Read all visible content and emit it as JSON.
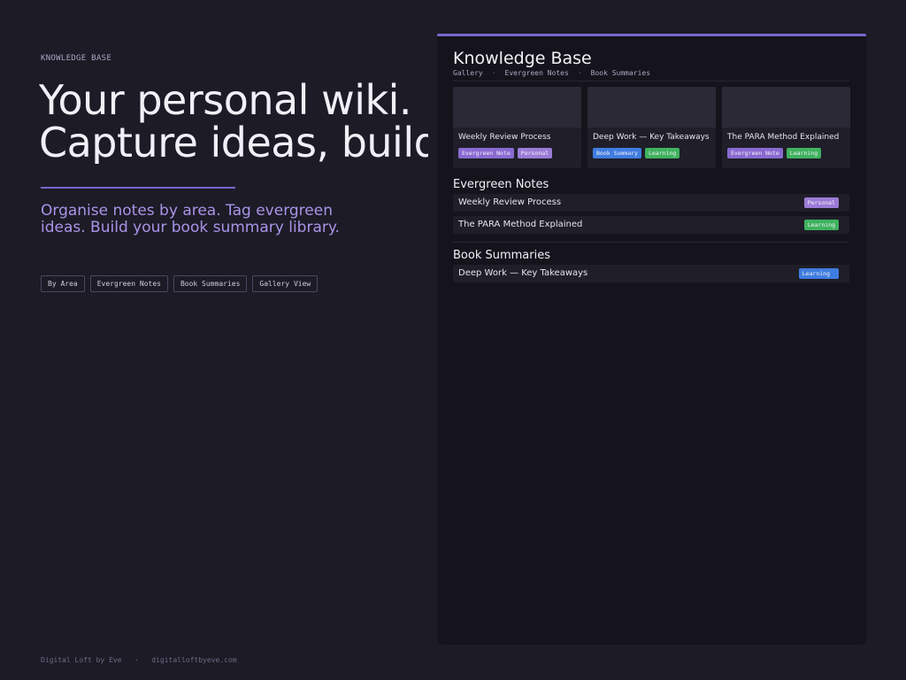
{
  "hero": {
    "eyebrow": "KNOWLEDGE BASE",
    "headline_line1": "Your personal wiki.",
    "headline_line2": "Capture ideas, build knowledge.",
    "subtitle": "Organise notes by area. Tag evergreen ideas. Build your book summary library.",
    "pills": [
      "By Area",
      "Evergreen Notes",
      "Book Summaries",
      "Gallery View"
    ]
  },
  "footer": {
    "brand": "Digital Loft by Eve",
    "separator": "·",
    "url": "digitalloftbyeve.com"
  },
  "panel": {
    "title": "Knowledge Base",
    "nav": [
      "Gallery",
      "Evergreen Notes",
      "Book Summaries"
    ],
    "nav_separator": "·",
    "cards": [
      {
        "title": "Weekly Review Process",
        "tags": [
          {
            "label": "Evergreen Note",
            "color": "#8a6ad1"
          },
          {
            "label": "Personal",
            "color": "#9b7bd6"
          }
        ]
      },
      {
        "title": "Deep Work — Key Takeaways",
        "tags": [
          {
            "label": "Book Summary",
            "color": "#3f7ce0"
          },
          {
            "label": "Learning",
            "color": "#3fb25e"
          }
        ]
      },
      {
        "title": "The PARA Method Explained",
        "tags": [
          {
            "label": "Evergreen Note",
            "color": "#8a6ad1"
          },
          {
            "label": "Learning",
            "color": "#3fb25e"
          }
        ]
      }
    ],
    "evergreen": {
      "title": "Evergreen Notes",
      "rows": [
        {
          "label": "Weekly Review Process",
          "tag": "Personal",
          "color": "#9b7bd6"
        },
        {
          "label": "The PARA Method Explained",
          "tag": "Learning",
          "color": "#3fb25e"
        }
      ]
    },
    "books": {
      "title": "Book Summaries",
      "rows": [
        {
          "label": "Deep Work — Key Takeaways",
          "tag": "Learning",
          "color": "#3f7ce0"
        }
      ]
    }
  },
  "colors": {
    "background": "#1c1b26",
    "panel": "#15141c",
    "accent": "#7b66cc",
    "subtitle": "#a994e8"
  }
}
